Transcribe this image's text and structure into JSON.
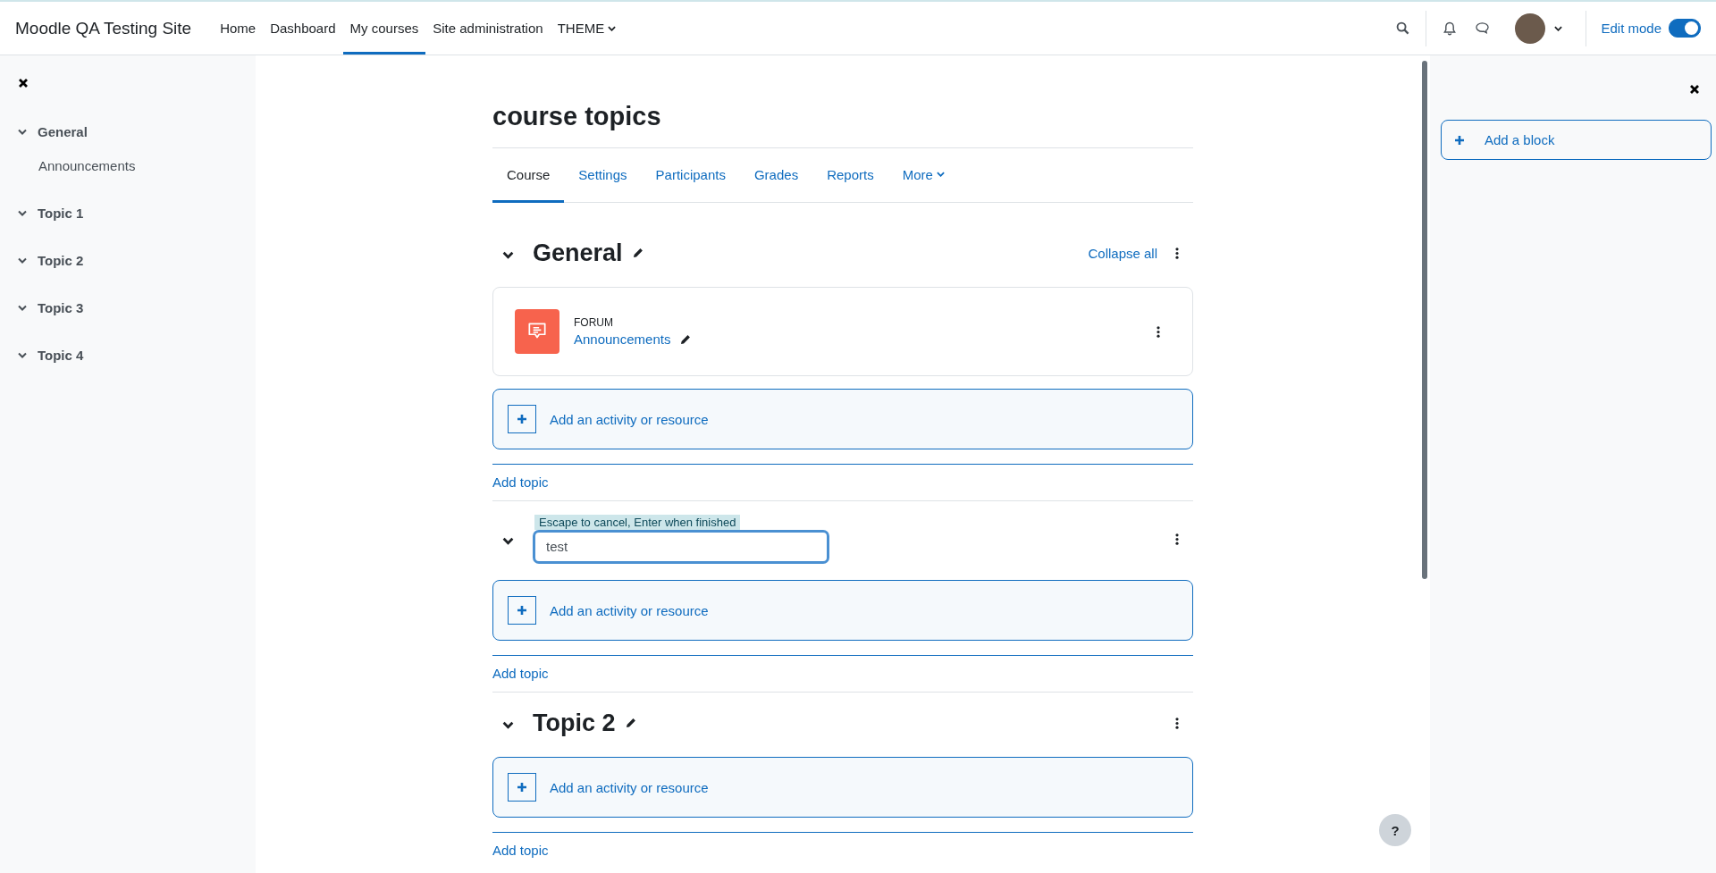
{
  "navbar": {
    "site_name": "Moodle QA Testing Site",
    "items": [
      {
        "label": "Home",
        "selected": false,
        "dropdown": false
      },
      {
        "label": "Dashboard",
        "selected": false,
        "dropdown": false
      },
      {
        "label": "My courses",
        "selected": true,
        "dropdown": false
      },
      {
        "label": "Site administration",
        "selected": false,
        "dropdown": false
      },
      {
        "label": "THEME",
        "selected": false,
        "dropdown": true
      }
    ],
    "edit_mode": {
      "label": "Edit mode",
      "on": true
    }
  },
  "course_index": {
    "items": [
      {
        "title": "General",
        "expanded": true,
        "children": [
          {
            "title": "Announcements"
          }
        ]
      },
      {
        "title": "Topic 1",
        "expanded": true
      },
      {
        "title": "Topic 2",
        "expanded": true
      },
      {
        "title": "Topic 3",
        "expanded": true
      },
      {
        "title": "Topic 4",
        "expanded": true
      }
    ]
  },
  "course": {
    "title": "course topics",
    "tabs": [
      {
        "label": "Course",
        "selected": true,
        "dropdown": false
      },
      {
        "label": "Settings",
        "selected": false,
        "dropdown": false
      },
      {
        "label": "Participants",
        "selected": false,
        "dropdown": false
      },
      {
        "label": "Grades",
        "selected": false,
        "dropdown": false
      },
      {
        "label": "Reports",
        "selected": false,
        "dropdown": false
      },
      {
        "label": "More",
        "selected": false,
        "dropdown": true
      }
    ],
    "collapse_all": "Collapse all",
    "sections": [
      {
        "kind": "heading",
        "title": "General",
        "activities": [
          {
            "type": "FORUM",
            "name": "Announcements"
          }
        ],
        "add_activity": "Add an activity or resource",
        "add_topic": "Add topic"
      },
      {
        "kind": "editing",
        "hint": "Escape to cancel, Enter when finished",
        "value": "test",
        "add_activity": "Add an activity or resource",
        "add_topic": "Add topic"
      },
      {
        "kind": "heading",
        "title": "Topic 2",
        "add_activity": "Add an activity or resource",
        "add_topic": "Add topic"
      }
    ]
  },
  "block_drawer": {
    "add_block": "Add a block"
  },
  "help_button": "?"
}
